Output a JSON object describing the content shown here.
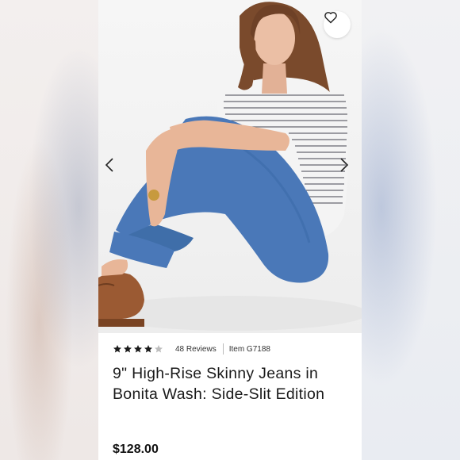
{
  "product": {
    "rating": 4,
    "rating_max": 5,
    "reviews_label": "48 Reviews",
    "item_label": "Item G7188",
    "title": "9\" High-Rise Skinny Jeans in Bonita Wash: Side-Slit Edition",
    "price": "$128.00"
  },
  "icons": {
    "favorite": "heart-outline-icon",
    "prev": "chevron-left-icon",
    "next": "chevron-right-icon",
    "star": "star-icon"
  },
  "colors": {
    "star_filled": "#1a1a1a",
    "star_empty": "#bdbdbd",
    "denim": "#4a78b8",
    "text": "#1a1a1a"
  }
}
